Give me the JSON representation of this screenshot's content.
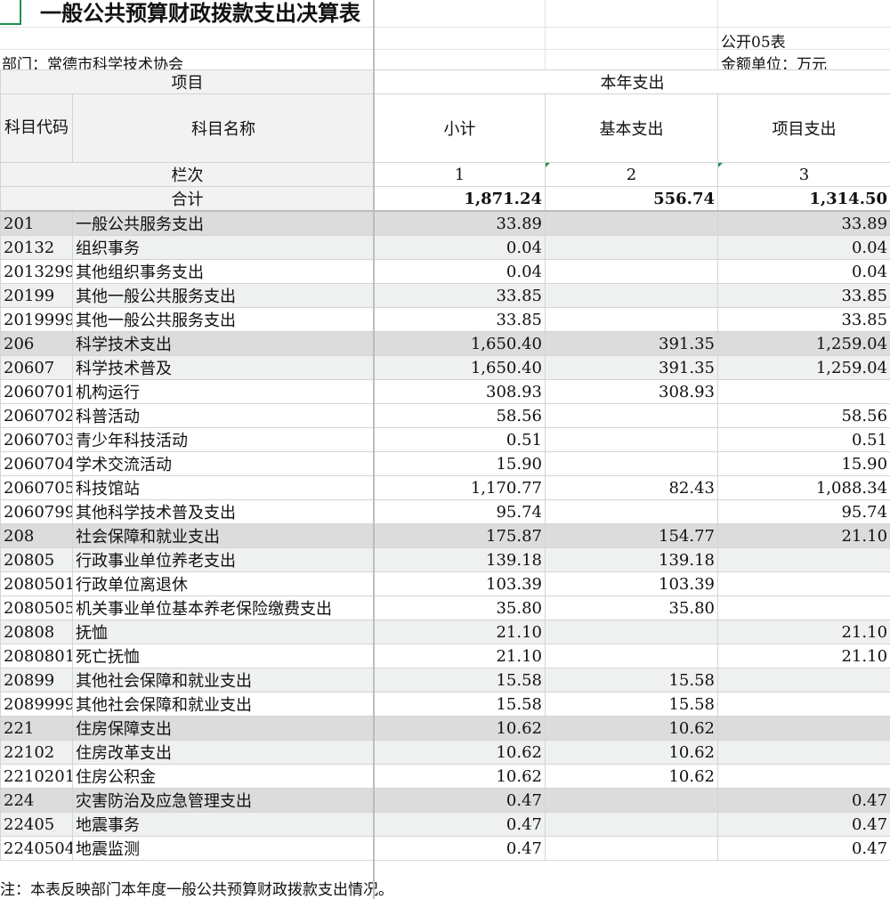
{
  "title": "一般公共预算财政拨款支出决算表",
  "form_no": "公开05表",
  "department": "部门：常德市科学技术协会",
  "unit": "金额单位：万元",
  "headers": {
    "project": "项目",
    "year_expense": "本年支出",
    "code": "科目代码",
    "name": "科目名称",
    "subtotal": "小计",
    "basic": "基本支出",
    "item": "项目支出",
    "col_label": "栏次",
    "col1": "1",
    "col2": "2",
    "col3": "3"
  },
  "total": {
    "label": "合计",
    "subtotal": "1,871.24",
    "basic": "556.74",
    "item": "1,314.50"
  },
  "rows": [
    {
      "code": "201",
      "name": "一般公共服务支出",
      "subtotal": "33.89",
      "basic": "",
      "item": "33.89",
      "level": 1
    },
    {
      "code": "20132",
      "name": "组织事务",
      "subtotal": "0.04",
      "basic": "",
      "item": "0.04",
      "level": 2
    },
    {
      "code": "2013299",
      "name": "其他组织事务支出",
      "subtotal": "0.04",
      "basic": "",
      "item": "0.04",
      "level": 3
    },
    {
      "code": "20199",
      "name": "其他一般公共服务支出",
      "subtotal": "33.85",
      "basic": "",
      "item": "33.85",
      "level": 2
    },
    {
      "code": "2019999",
      "name": "其他一般公共服务支出",
      "subtotal": "33.85",
      "basic": "",
      "item": "33.85",
      "level": 3
    },
    {
      "code": "206",
      "name": "科学技术支出",
      "subtotal": "1,650.40",
      "basic": "391.35",
      "item": "1,259.04",
      "level": 1
    },
    {
      "code": "20607",
      "name": "科学技术普及",
      "subtotal": "1,650.40",
      "basic": "391.35",
      "item": "1,259.04",
      "level": 2
    },
    {
      "code": "2060701",
      "name": "机构运行",
      "subtotal": "308.93",
      "basic": "308.93",
      "item": "",
      "level": 3
    },
    {
      "code": "2060702",
      "name": "科普活动",
      "subtotal": "58.56",
      "basic": "",
      "item": "58.56",
      "level": 3
    },
    {
      "code": "2060703",
      "name": "青少年科技活动",
      "subtotal": "0.51",
      "basic": "",
      "item": "0.51",
      "level": 3
    },
    {
      "code": "2060704",
      "name": "学术交流活动",
      "subtotal": "15.90",
      "basic": "",
      "item": "15.90",
      "level": 3
    },
    {
      "code": "2060705",
      "name": "科技馆站",
      "subtotal": "1,170.77",
      "basic": "82.43",
      "item": "1,088.34",
      "level": 3
    },
    {
      "code": "2060799",
      "name": "其他科学技术普及支出",
      "subtotal": "95.74",
      "basic": "",
      "item": "95.74",
      "level": 3
    },
    {
      "code": "208",
      "name": "社会保障和就业支出",
      "subtotal": "175.87",
      "basic": "154.77",
      "item": "21.10",
      "level": 1
    },
    {
      "code": "20805",
      "name": "行政事业单位养老支出",
      "subtotal": "139.18",
      "basic": "139.18",
      "item": "",
      "level": 2
    },
    {
      "code": "2080501",
      "name": "行政单位离退休",
      "subtotal": "103.39",
      "basic": "103.39",
      "item": "",
      "level": 3
    },
    {
      "code": "2080505",
      "name": "机关事业单位基本养老保险缴费支出",
      "subtotal": "35.80",
      "basic": "35.80",
      "item": "",
      "level": 3
    },
    {
      "code": "20808",
      "name": "抚恤",
      "subtotal": "21.10",
      "basic": "",
      "item": "21.10",
      "level": 2
    },
    {
      "code": "2080801",
      "name": "死亡抚恤",
      "subtotal": "21.10",
      "basic": "",
      "item": "21.10",
      "level": 3
    },
    {
      "code": "20899",
      "name": "其他社会保障和就业支出",
      "subtotal": "15.58",
      "basic": "15.58",
      "item": "",
      "level": 2
    },
    {
      "code": "2089999",
      "name": "其他社会保障和就业支出",
      "subtotal": "15.58",
      "basic": "15.58",
      "item": "",
      "level": 3
    },
    {
      "code": "221",
      "name": "住房保障支出",
      "subtotal": "10.62",
      "basic": "10.62",
      "item": "",
      "level": 1
    },
    {
      "code": "22102",
      "name": "住房改革支出",
      "subtotal": "10.62",
      "basic": "10.62",
      "item": "",
      "level": 2
    },
    {
      "code": "2210201",
      "name": "住房公积金",
      "subtotal": "10.62",
      "basic": "10.62",
      "item": "",
      "level": 3
    },
    {
      "code": "224",
      "name": "灾害防治及应急管理支出",
      "subtotal": "0.47",
      "basic": "",
      "item": "0.47",
      "level": 1
    },
    {
      "code": "22405",
      "name": "地震事务",
      "subtotal": "0.47",
      "basic": "",
      "item": "0.47",
      "level": 2
    },
    {
      "code": "2240504",
      "name": "地震监测",
      "subtotal": "0.47",
      "basic": "",
      "item": "0.47",
      "level": 3
    }
  ],
  "note": "注：本表反映部门本年度一般公共预算财政拨款支出情况。"
}
